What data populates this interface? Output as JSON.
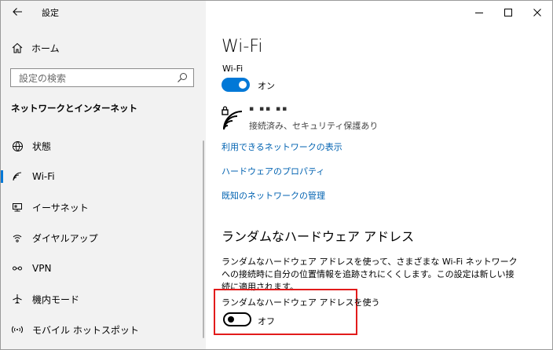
{
  "app": {
    "title": "設定"
  },
  "sidebar": {
    "home_label": "ホーム",
    "search_placeholder": "設定の検索",
    "section_title": "ネットワークとインターネット",
    "items": [
      {
        "label": "状態",
        "icon": "globe-icon"
      },
      {
        "label": "Wi-Fi",
        "icon": "wifi-icon",
        "selected": true
      },
      {
        "label": "イーサネット",
        "icon": "ethernet-icon"
      },
      {
        "label": "ダイヤルアップ",
        "icon": "dialup-icon"
      },
      {
        "label": "VPN",
        "icon": "vpn-icon"
      },
      {
        "label": "機内モード",
        "icon": "airplane-icon"
      },
      {
        "label": "モバイル ホットスポット",
        "icon": "hotspot-icon"
      }
    ]
  },
  "main": {
    "title": "Wi-Fi",
    "wifi_label": "Wi-Fi",
    "wifi_toggle": {
      "state": "on",
      "label": "オン"
    },
    "network": {
      "name": "▪ ▪▪ ▪▪",
      "status": "接続済み、セキュリティ保護あり"
    },
    "links": [
      "利用できるネットワークの表示",
      "ハードウェアのプロパティ",
      "既知のネットワークの管理"
    ],
    "random_section": {
      "heading": "ランダムなハードウェア アドレス",
      "description": "ランダムなハードウェア アドレスを使って、さまざまな Wi-Fi ネットワークへの接続時に自分の位置情報を追跡されにくくします。この設定は新しい接続に適用されます。",
      "setting_label": "ランダムなハードウェア アドレスを使う",
      "toggle": {
        "state": "off",
        "label": "オフ"
      }
    }
  },
  "colors": {
    "accent": "#0078d7",
    "link": "#0062b1",
    "highlight": "#e21b1b",
    "sidebar_bg": "#f2f2f2"
  }
}
